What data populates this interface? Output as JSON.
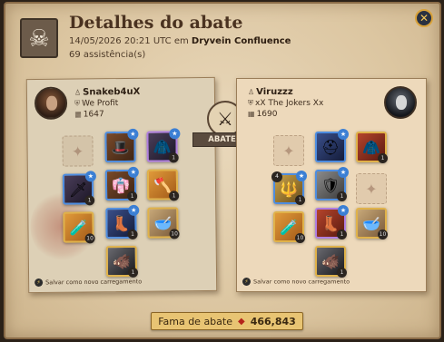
{
  "header": {
    "title": "Detalhes do abate",
    "date": "14/05/2026 20:21 UTC em",
    "location": "Dryvein Confluence",
    "assists": "69 assistência(s)"
  },
  "killer": {
    "name": "Snakeb4uX",
    "guild": "We Profit",
    "ip": "1647",
    "save_label": "Salvar como novo carregamento"
  },
  "victim": {
    "name": "Viruzzz",
    "guild": "xX The Jokers Xx",
    "ip": "1690",
    "save_label": "Salvar como novo carregamento"
  },
  "center": {
    "killed_label": "ABATEU"
  },
  "fame": {
    "label": "Fama de abate",
    "value": "466,843"
  },
  "icons": {
    "emblem": "skull-crossbones-icon",
    "close": "close-icon",
    "versus": "crossed-swords-icon",
    "fame": "fame-icon"
  }
}
